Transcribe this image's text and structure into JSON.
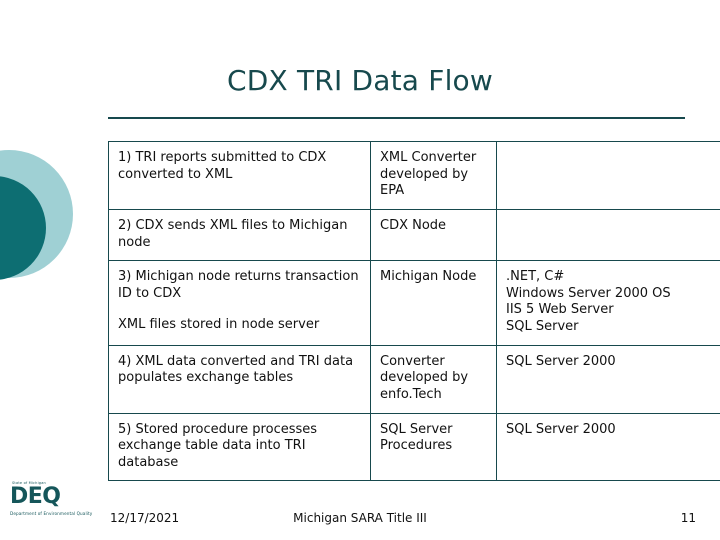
{
  "slide": {
    "title": "CDX TRI Data Flow",
    "accent_color": "#17494d",
    "circle_outer_color": "#9fd0d4",
    "circle_inner_color": "#0d6e72"
  },
  "table": {
    "rows": [
      {
        "step": "1) TRI reports submitted to CDX converted to XML",
        "component": "XML Converter developed by EPA",
        "tech": ""
      },
      {
        "step": "2) CDX sends XML files to Michigan node",
        "component": "CDX Node",
        "tech": ""
      },
      {
        "step_line1": "3) Michigan node returns transaction ID to CDX",
        "step_line2": "XML files stored in node server",
        "component": "Michigan Node",
        "tech_lines": [
          ".NET, C#",
          "Windows Server 2000 OS",
          "IIS 5 Web Server",
          "SQL Server"
        ]
      },
      {
        "step": "4) XML data converted and TRI data populates exchange tables",
        "component": "Converter developed by enfo.Tech",
        "tech": "SQL Server 2000"
      },
      {
        "step": "5) Stored procedure processes exchange table data into TRI database",
        "component": "SQL Server Procedures",
        "tech": "SQL Server 2000"
      }
    ]
  },
  "footer": {
    "date": "12/17/2021",
    "center": "Michigan SARA Title III",
    "page": "11"
  },
  "logo": {
    "top_text": "State of Michigan",
    "main_text": "DEQ",
    "sub_text": "Department of Environmental Quality"
  }
}
